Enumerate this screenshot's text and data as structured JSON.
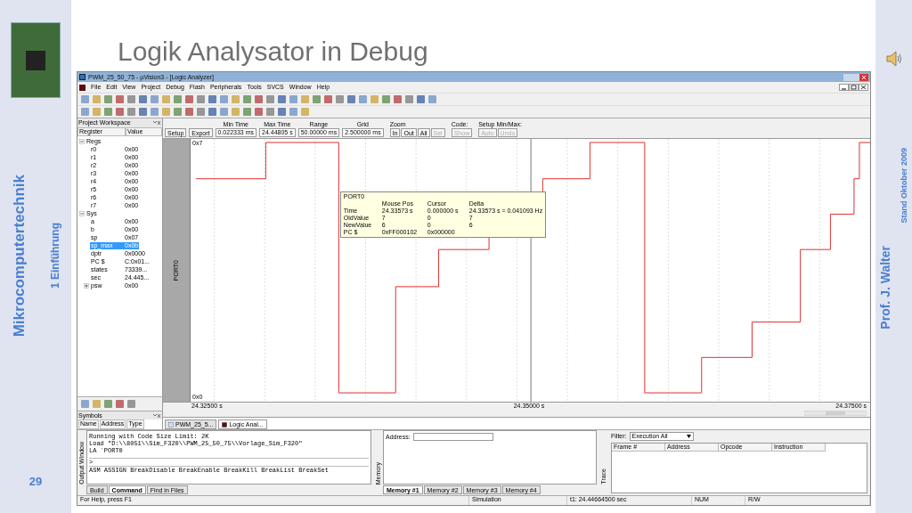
{
  "slide": {
    "title": "Logik Analysator in Debug",
    "course": "Mikrocomputertechnik",
    "chapter": "1 Einführung",
    "page_number": "29",
    "date": "Stand Oktober 2009",
    "author": "Prof. J. Walter"
  },
  "window": {
    "title": "PWM_25_50_75 - µVision3 - [Logic Analyzer]"
  },
  "menu": [
    "File",
    "Edit",
    "View",
    "Project",
    "Debug",
    "Flash",
    "Peripherals",
    "Tools",
    "SVCS",
    "Window",
    "Help"
  ],
  "workspace": {
    "title": "Project Workspace",
    "columns": [
      "Register",
      "Value"
    ],
    "tree": [
      {
        "label": "Regs",
        "expanded": true,
        "children": [
          {
            "label": "r0",
            "value": "0x00",
            "selected": false
          },
          {
            "label": "r1",
            "value": "0x00",
            "selected": false
          },
          {
            "label": "r2",
            "value": "0x00",
            "selected": false
          },
          {
            "label": "r3",
            "value": "0x00",
            "selected": false
          },
          {
            "label": "r4",
            "value": "0x00",
            "selected": false
          },
          {
            "label": "r5",
            "value": "0x00",
            "selected": false
          },
          {
            "label": "r6",
            "value": "0x00",
            "selected": false
          },
          {
            "label": "r7",
            "value": "0x00",
            "selected": false
          }
        ]
      },
      {
        "label": "Sys",
        "expanded": true,
        "children": [
          {
            "label": "a",
            "value": "0x00",
            "selected": false
          },
          {
            "label": "b",
            "value": "0x00",
            "selected": false
          },
          {
            "label": "sp",
            "value": "0x07",
            "selected": false
          },
          {
            "label": "sp_max",
            "value": "0x0b",
            "selected": true
          },
          {
            "label": "dptr",
            "value": "0x0000",
            "selected": false
          },
          {
            "label": "PC  $",
            "value": "C:0x01...",
            "selected": false
          },
          {
            "label": "states",
            "value": "73339...",
            "selected": false
          },
          {
            "label": "sec",
            "value": "24.445...",
            "selected": false
          },
          {
            "label": "psw",
            "value": "0x00",
            "selected": false,
            "expanded": false
          }
        ]
      }
    ]
  },
  "symbols": {
    "title": "Symbols",
    "columns": [
      "Name",
      "Address",
      "Type"
    ]
  },
  "analyzer": {
    "buttons": [
      "Setup",
      "Export"
    ],
    "fields": [
      {
        "label": "Min Time",
        "value": "0.022333 ms"
      },
      {
        "label": "Max Time",
        "value": "24.44805 s"
      },
      {
        "label": "Range",
        "value": "50.00000 ms"
      },
      {
        "label": "Grid",
        "value": "2.500000 ms"
      }
    ],
    "zoom": {
      "label": "Zoom",
      "buttons": [
        {
          "label": "In",
          "disabled": false
        },
        {
          "label": "Out",
          "disabled": false
        },
        {
          "label": "All",
          "disabled": false
        },
        {
          "label": "Sel",
          "disabled": true
        }
      ]
    },
    "code": {
      "label": "Code:",
      "buttons": [
        {
          "label": "Show",
          "disabled": true
        }
      ]
    },
    "minmax": {
      "label": "Setup Min/Max:",
      "buttons": [
        {
          "label": "Auto",
          "disabled": true
        },
        {
          "label": "Undo",
          "disabled": true
        }
      ]
    },
    "signal": "PORT0",
    "y_top": "0x7",
    "y_bottom": "0x0",
    "x_labels": [
      "24.32500 s",
      "24.35000 s",
      "24.37500 s"
    ],
    "tooltip": {
      "title": "PORT0",
      "columns": [
        "Mouse Pos",
        "Cursor",
        "Delta"
      ],
      "rows": [
        {
          "label": "Time",
          "cells": [
            "24.33573 s",
            "0.000000 s",
            "24.33573 s = 0.041093 Hz"
          ]
        },
        {
          "label": "OldValue",
          "cells": [
            "7",
            "0",
            "7"
          ]
        },
        {
          "label": "NewValue",
          "cells": [
            "6",
            "0",
            "6"
          ]
        },
        {
          "label": "PC $",
          "cells": [
            "0xFF000102",
            "0x000000"
          ]
        }
      ]
    }
  },
  "doc_tabs": [
    {
      "label": "PWM_25_5...",
      "selected": false
    },
    {
      "label": "Logic Anal...",
      "selected": true
    }
  ],
  "output": {
    "title": "Output Window",
    "lines": [
      "Running with Code Size Limit: 2K",
      "Load \"D:\\\\8051\\\\Sim_F320\\\\PWM_25_50_75\\\\Vorlage_Sim_F320\"",
      "LA `PORT0"
    ],
    "prompt": ">",
    "hint": "ASM ASSIGN BreakDisable BreakEnable BreakKill BreakList BreakSet",
    "tabs": [
      {
        "label": "Build",
        "selected": false
      },
      {
        "label": "Command",
        "selected": true
      },
      {
        "label": "Find in Files",
        "selected": false
      }
    ]
  },
  "memory": {
    "title": "Memory",
    "address_label": "Address:",
    "tabs": [
      {
        "label": "Memory #1",
        "selected": true
      },
      {
        "label": "Memory #2",
        "selected": false
      },
      {
        "label": "Memory #3",
        "selected": false
      },
      {
        "label": "Memory #4",
        "selected": false
      }
    ]
  },
  "trace": {
    "title": "Trace",
    "filter_label": "Filter:",
    "filter_value": "Execution All",
    "columns": [
      "Frame #",
      "Address",
      "Opcode",
      "Instruction"
    ]
  },
  "status_bar": [
    "For Help, press F1",
    "Simulation",
    "t1: 24.44664500 sec",
    "NUM",
    "R/W"
  ]
}
